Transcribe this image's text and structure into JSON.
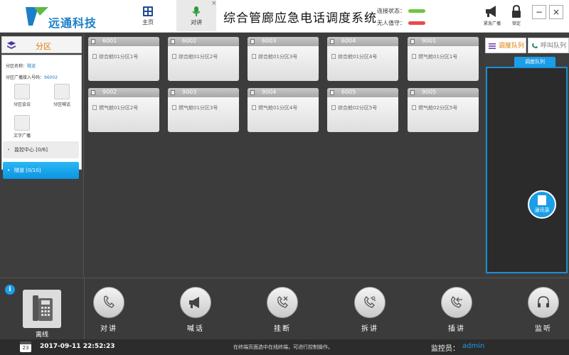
{
  "header": {
    "logo_text": "远通科技",
    "nav": [
      {
        "label": "主页",
        "icon": "grid-icon"
      },
      {
        "label": "对讲",
        "icon": "microphone-icon"
      }
    ],
    "tab_close": "×",
    "title": "综合管廊应急电话调度系统",
    "status": {
      "connection_label": "连接状态：",
      "connection_color": "#6dc640",
      "unattended_label": "无人值守：",
      "unattended_color": "#e84b4b"
    },
    "buttons": {
      "broadcast": "紧急广播",
      "lock": "锁定"
    },
    "window": {
      "minimize": "−",
      "close": "×"
    }
  },
  "left": {
    "zone_title": "分区",
    "zone_name_label": "分区名称：",
    "zone_name_value": "隧道",
    "broadcast_num_label": "分区广播接入号码：",
    "broadcast_num_value": "96002",
    "buttons": [
      "分区会议",
      "分区喊话",
      "文字广播"
    ],
    "list": [
      {
        "label": "监控中心 [0/6]"
      },
      {
        "label": "隧道 [0/10]"
      }
    ]
  },
  "cards": [
    {
      "num": "6001",
      "name": "综合舱01分区1号"
    },
    {
      "num": "6002",
      "name": "综合舱01分区2号"
    },
    {
      "num": "6003",
      "name": "综合舱01分区3号"
    },
    {
      "num": "6004",
      "name": "综合舱01分区4号"
    },
    {
      "num": "9001",
      "name": "燃气舱01分区1号"
    },
    {
      "num": "9002",
      "name": "燃气舱01分区2号"
    },
    {
      "num": "9003",
      "name": "燃气舱01分区3号"
    },
    {
      "num": "9004",
      "name": "燃气舱01分区4号"
    },
    {
      "num": "6005",
      "name": "综合舱02分区5号"
    },
    {
      "num": "9005",
      "name": "燃气舱02分区5号"
    }
  ],
  "right": {
    "tab_queue": "调度队列",
    "tab_call_queue": "呼叫队列",
    "sub_tab": "调度队列",
    "contacts": "通讯录"
  },
  "toolbar": {
    "phone_label": "离线",
    "tools": [
      "对讲",
      "喊话",
      "挂断",
      "拆讲",
      "插讲",
      "监听"
    ]
  },
  "statusbar": {
    "calendar_day": "23",
    "datetime": "2017-09-11  22:52:23",
    "hint": "在终端页面选中在线终端，可进行控制操作。",
    "monitor_label": "监控员：",
    "monitor_value": "admin"
  }
}
